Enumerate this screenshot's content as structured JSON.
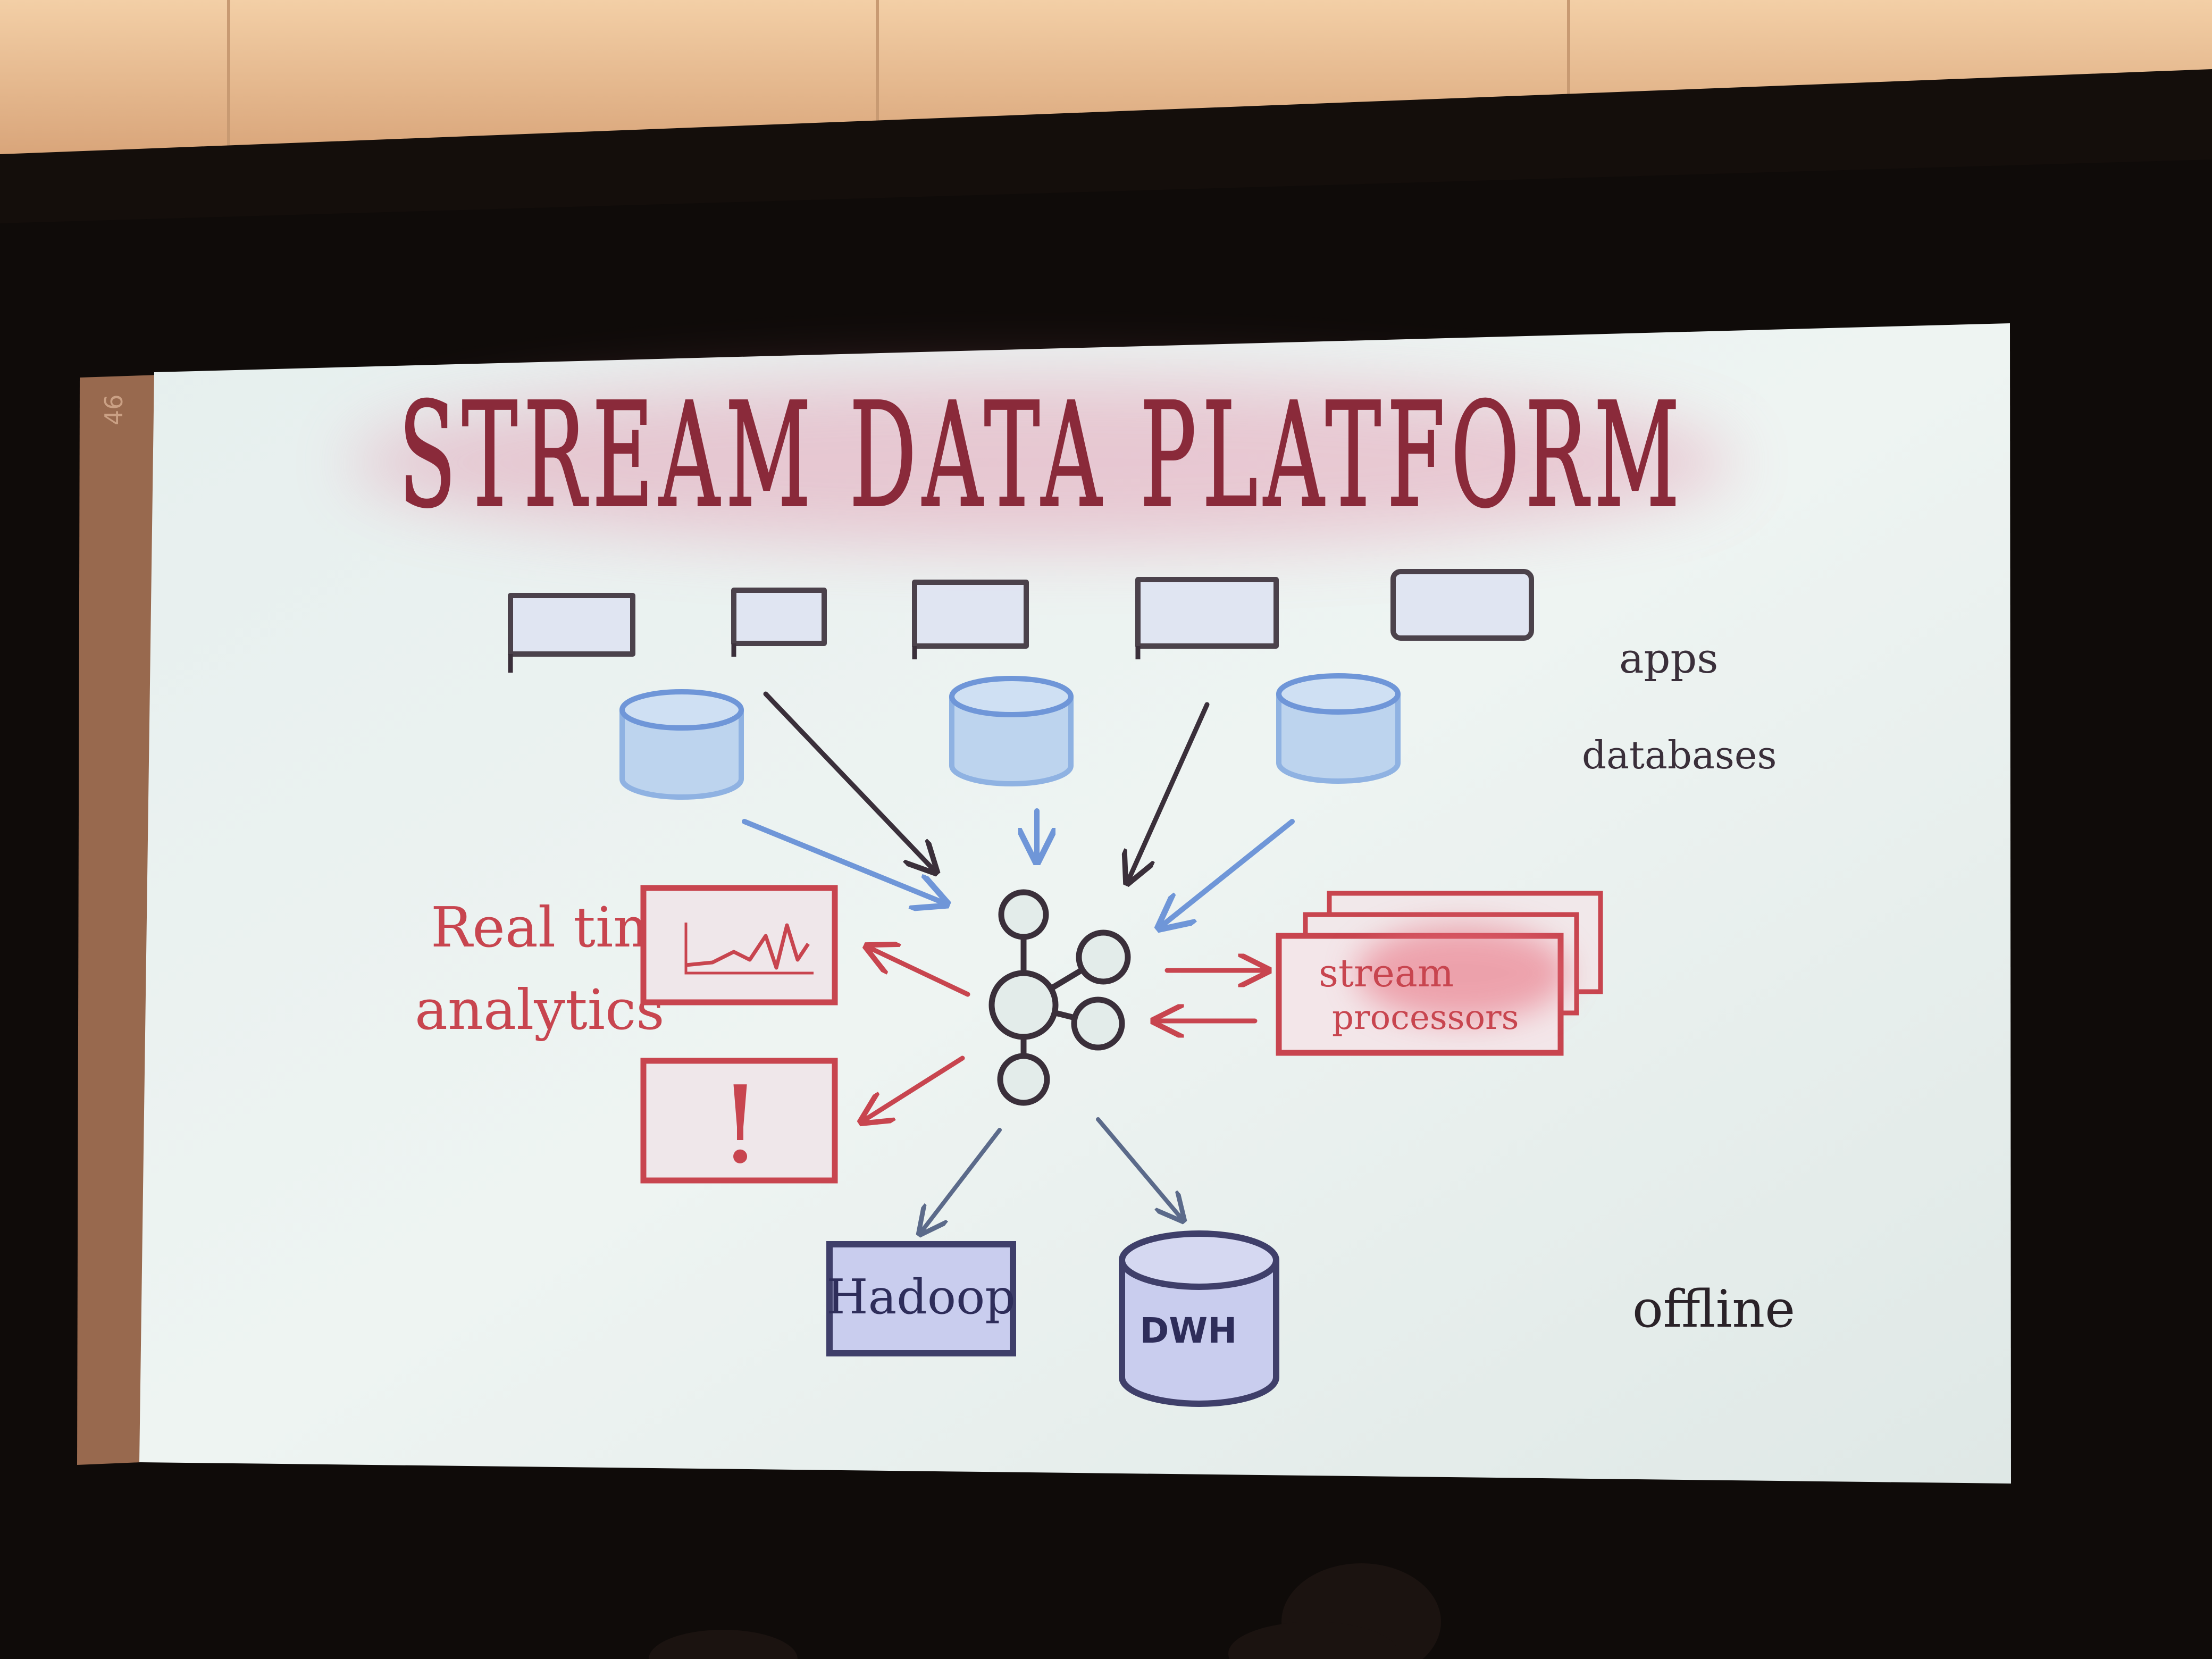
{
  "slide": {
    "title": "STREAM DATA PLATFORM",
    "labels": {
      "apps": "apps",
      "databases": "databases",
      "realtime_line1": "Real time",
      "realtime_line2": "analytics",
      "alert_mark": "!",
      "stream_line1": "stream",
      "stream_line2": "processors",
      "hadoop": "Hadoop",
      "dwh": "DWH",
      "offline": "offline"
    }
  },
  "colors": {
    "title": "#8a2a3a",
    "title_glow": "#e07a9a",
    "ink_dark": "#3a2f3a",
    "ink_red": "#c8454f",
    "ink_blue": "#6f96d8",
    "cyl_fill": "#bdd4ee",
    "box_fill": "#c9cdee",
    "red_glow": "#e86a7a",
    "screen": "#e3ecea",
    "wall": "#f0caa0",
    "frame": "#0f0b09"
  }
}
